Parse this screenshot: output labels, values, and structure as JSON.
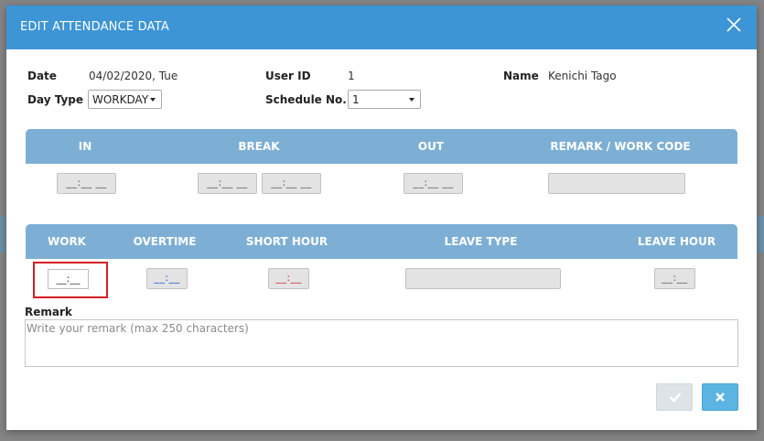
{
  "modal": {
    "title": "EDIT ATTENDANCE DATA"
  },
  "info": {
    "date_label": "Date",
    "date_value": "04/02/2020, Tue",
    "user_id_label": "User ID",
    "user_id_value": "1",
    "name_label": "Name",
    "name_value": "Kenichi Tago",
    "day_type_label": "Day Type",
    "day_type_value": "WORKDAY",
    "schedule_label": "Schedule No.",
    "schedule_value": "1"
  },
  "time_table": {
    "headers": [
      "IN",
      "BREAK",
      "OUT",
      "REMARK / WORK CODE"
    ],
    "in_value": "__:__ __",
    "break_start": "__:__ __",
    "break_end": "__:__ __",
    "out_value": "__:__ __",
    "remark_code": ""
  },
  "hours_table": {
    "headers": [
      "WORK",
      "OVERTIME",
      "SHORT HOUR",
      "LEAVE TYPE",
      "LEAVE HOUR"
    ],
    "work": "__:__",
    "overtime": "__:__",
    "short_hour": "__:__",
    "leave_type": "",
    "leave_hour": "__:__"
  },
  "remark": {
    "label": "Remark",
    "placeholder": "Write your remark (max 250 characters)"
  },
  "colors": {
    "header_bg": "#3d95d6",
    "table_header_bg": "#7dafd4",
    "overtime_text": "#1a4fd6",
    "short_hour_text": "#d41e24",
    "highlight": "#d41e24",
    "cancel_button": "#5bb4e2"
  },
  "icons": {
    "close": "close-icon",
    "confirm": "check-icon",
    "cancel": "x-icon"
  }
}
